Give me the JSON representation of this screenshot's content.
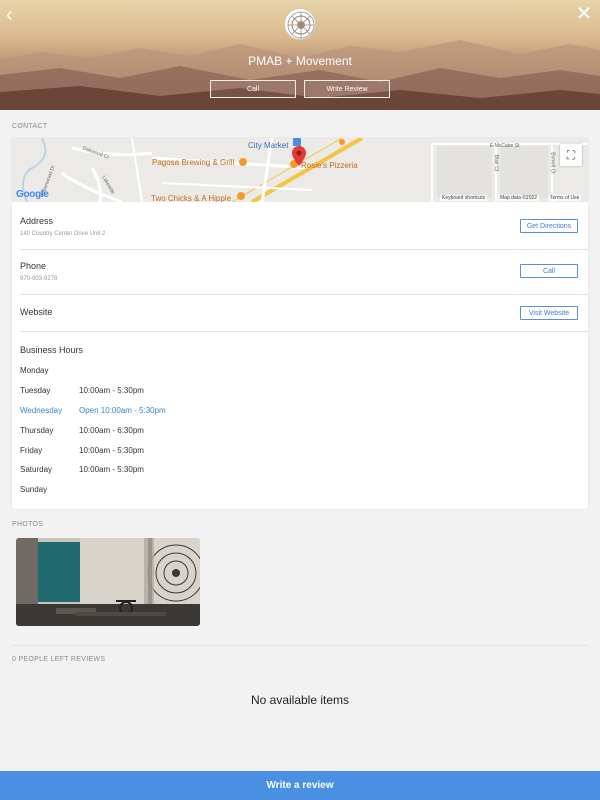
{
  "header": {
    "business_name": "PMAB + Movement",
    "call_label": "Call",
    "write_review_label": "Write Review",
    "back_icon": "chevron-left-icon",
    "close_icon": "close-icon"
  },
  "contact": {
    "section_label": "CONTACT",
    "map": {
      "labels": {
        "city_market": "City Market",
        "pagosa_brewing": "Pagosa Brewing & Grill",
        "rosies_pizzeria": "Rosie's Pizzeria",
        "two_chicks": "Two Chicks & A Hippie",
        "e_mccabe": "E McCabe St",
        "dakwood": "Dakwood Ct",
        "lakeside": "Lakeside",
        "blair": "Blair Ct",
        "bonwit": "Bonwit Ct",
        "greenwood": "Greenwood Dr",
        "google": "Google",
        "keyboard_shortcuts": "Keyboard shortcuts",
        "map_data": "Map data ©2022",
        "terms": "Terms of Use"
      }
    },
    "address": {
      "title": "Address",
      "value": "140 Country Center Drive Unit 2",
      "button": "Get Directions"
    },
    "phone": {
      "title": "Phone",
      "value": "970-903-9278",
      "button": "Call"
    },
    "website": {
      "title": "Website",
      "button": "Visit Website"
    },
    "hours": {
      "title": "Business Hours",
      "days": [
        {
          "day": "Monday",
          "time": ""
        },
        {
          "day": "Tuesday",
          "time": "10:00am - 5:30pm"
        },
        {
          "day": "Wednesday",
          "time": "Open 10:00am - 5:30pm"
        },
        {
          "day": "Thursday",
          "time": "10:00am - 6:30pm"
        },
        {
          "day": "Friday",
          "time": "10:00am - 5:30pm"
        },
        {
          "day": "Saturday",
          "time": "10:00am - 5:30pm"
        },
        {
          "day": "Sunday",
          "time": ""
        }
      ]
    }
  },
  "photos": {
    "section_label": "PHOTOS"
  },
  "reviews": {
    "section_label": "0 PEOPLE LEFT REVIEWS",
    "empty_text": "No available items"
  },
  "footer": {
    "write_review_label": "Write a review"
  },
  "colors": {
    "accent": "#4a90e2",
    "today": "#3d86c6",
    "map_pin": "#e53935"
  }
}
